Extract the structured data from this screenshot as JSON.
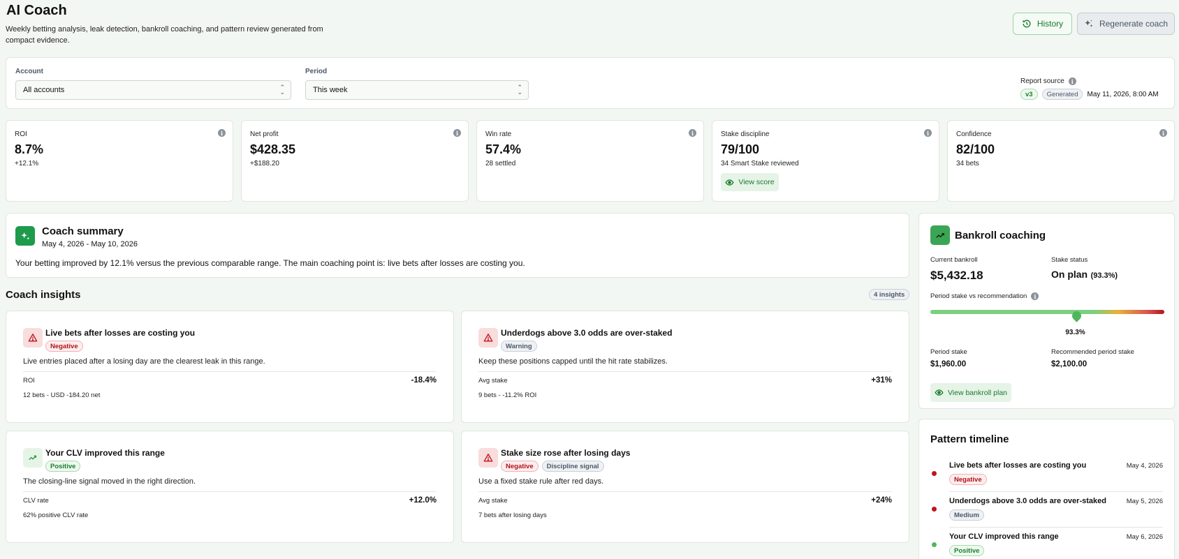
{
  "header": {
    "title": "AI Coach",
    "description": "Weekly betting analysis, leak detection, bankroll coaching, and pattern review generated from compact evidence.",
    "history_label": "History",
    "regenerate_label": "Regenerate coach"
  },
  "filters": {
    "account_label": "Account",
    "account_value": "All accounts",
    "period_label": "Period",
    "period_value": "This week",
    "report_source_label": "Report source",
    "version_tag": "v3",
    "generated_tag": "Generated",
    "generated_at": "May 11, 2026, 8:00 AM"
  },
  "kpis": [
    {
      "label": "ROI",
      "value": "8.7%",
      "sub": "+12.1%"
    },
    {
      "label": "Net profit",
      "value": "$428.35",
      "sub": "+$188.20"
    },
    {
      "label": "Win rate",
      "value": "57.4%",
      "sub": "28 settled"
    },
    {
      "label": "Stake discipline",
      "value": "79/100",
      "sub": "34 Smart Stake reviewed",
      "action": "View score"
    },
    {
      "label": "Confidence",
      "value": "82/100",
      "sub": "34 bets"
    }
  ],
  "summary": {
    "title": "Coach summary",
    "range": "May 4, 2026 - May 10, 2026",
    "text": "Your betting improved by 12.1% versus the previous comparable range. The main coaching point is: live bets after losses are costing you."
  },
  "insights": {
    "title": "Coach insights",
    "count_label": "4 insights",
    "items": [
      {
        "title": "Live bets after losses are costing you",
        "tags": [
          "Negative"
        ],
        "desc": "Live entries placed after a losing day are the clearest leak in this range.",
        "metric_label": "ROI",
        "metric_value": "-18.4%",
        "foot": "12 bets - USD -184.20 net"
      },
      {
        "title": "Underdogs above 3.0 odds are over-staked",
        "tags": [
          "Warning"
        ],
        "desc": "Keep these positions capped until the hit rate stabilizes.",
        "metric_label": "Avg stake",
        "metric_value": "+31%",
        "foot": "9 bets - -11.2% ROI"
      },
      {
        "title": "Your CLV improved this range",
        "tags": [
          "Positive"
        ],
        "desc": "The closing-line signal moved in the right direction.",
        "metric_label": "CLV rate",
        "metric_value": "+12.0%",
        "foot": "62% positive CLV rate"
      },
      {
        "title": "Stake size rose after losing days",
        "tags": [
          "Negative",
          "Discipline signal"
        ],
        "desc": "Use a fixed stake rule after red days.",
        "metric_label": "Avg stake",
        "metric_value": "+24%",
        "foot": "7 bets after losing days"
      }
    ]
  },
  "bankroll": {
    "title": "Bankroll coaching",
    "current_label": "Current bankroll",
    "current_value": "$5,432.18",
    "status_label": "Stake status",
    "status_value": "On plan",
    "status_pct": "(93.3%)",
    "gauge_label": "Period stake vs recommendation",
    "gauge_value": 0.625,
    "gauge_text": "93.3%",
    "period_stake_label": "Period stake",
    "period_stake_value": "$1,960.00",
    "recommended_label": "Recommended period stake",
    "recommended_value": "$2,100.00",
    "action": "View bankroll plan"
  },
  "timeline": {
    "title": "Pattern timeline",
    "items": [
      {
        "title": "Live bets after losses are costing you",
        "date": "May 4, 2026",
        "tag": "Negative"
      },
      {
        "title": "Underdogs above 3.0 odds are over-staked",
        "date": "May 5, 2026",
        "tag": "Medium"
      },
      {
        "title": "Your CLV improved this range",
        "date": "May 6, 2026",
        "tag": "Positive"
      }
    ]
  }
}
